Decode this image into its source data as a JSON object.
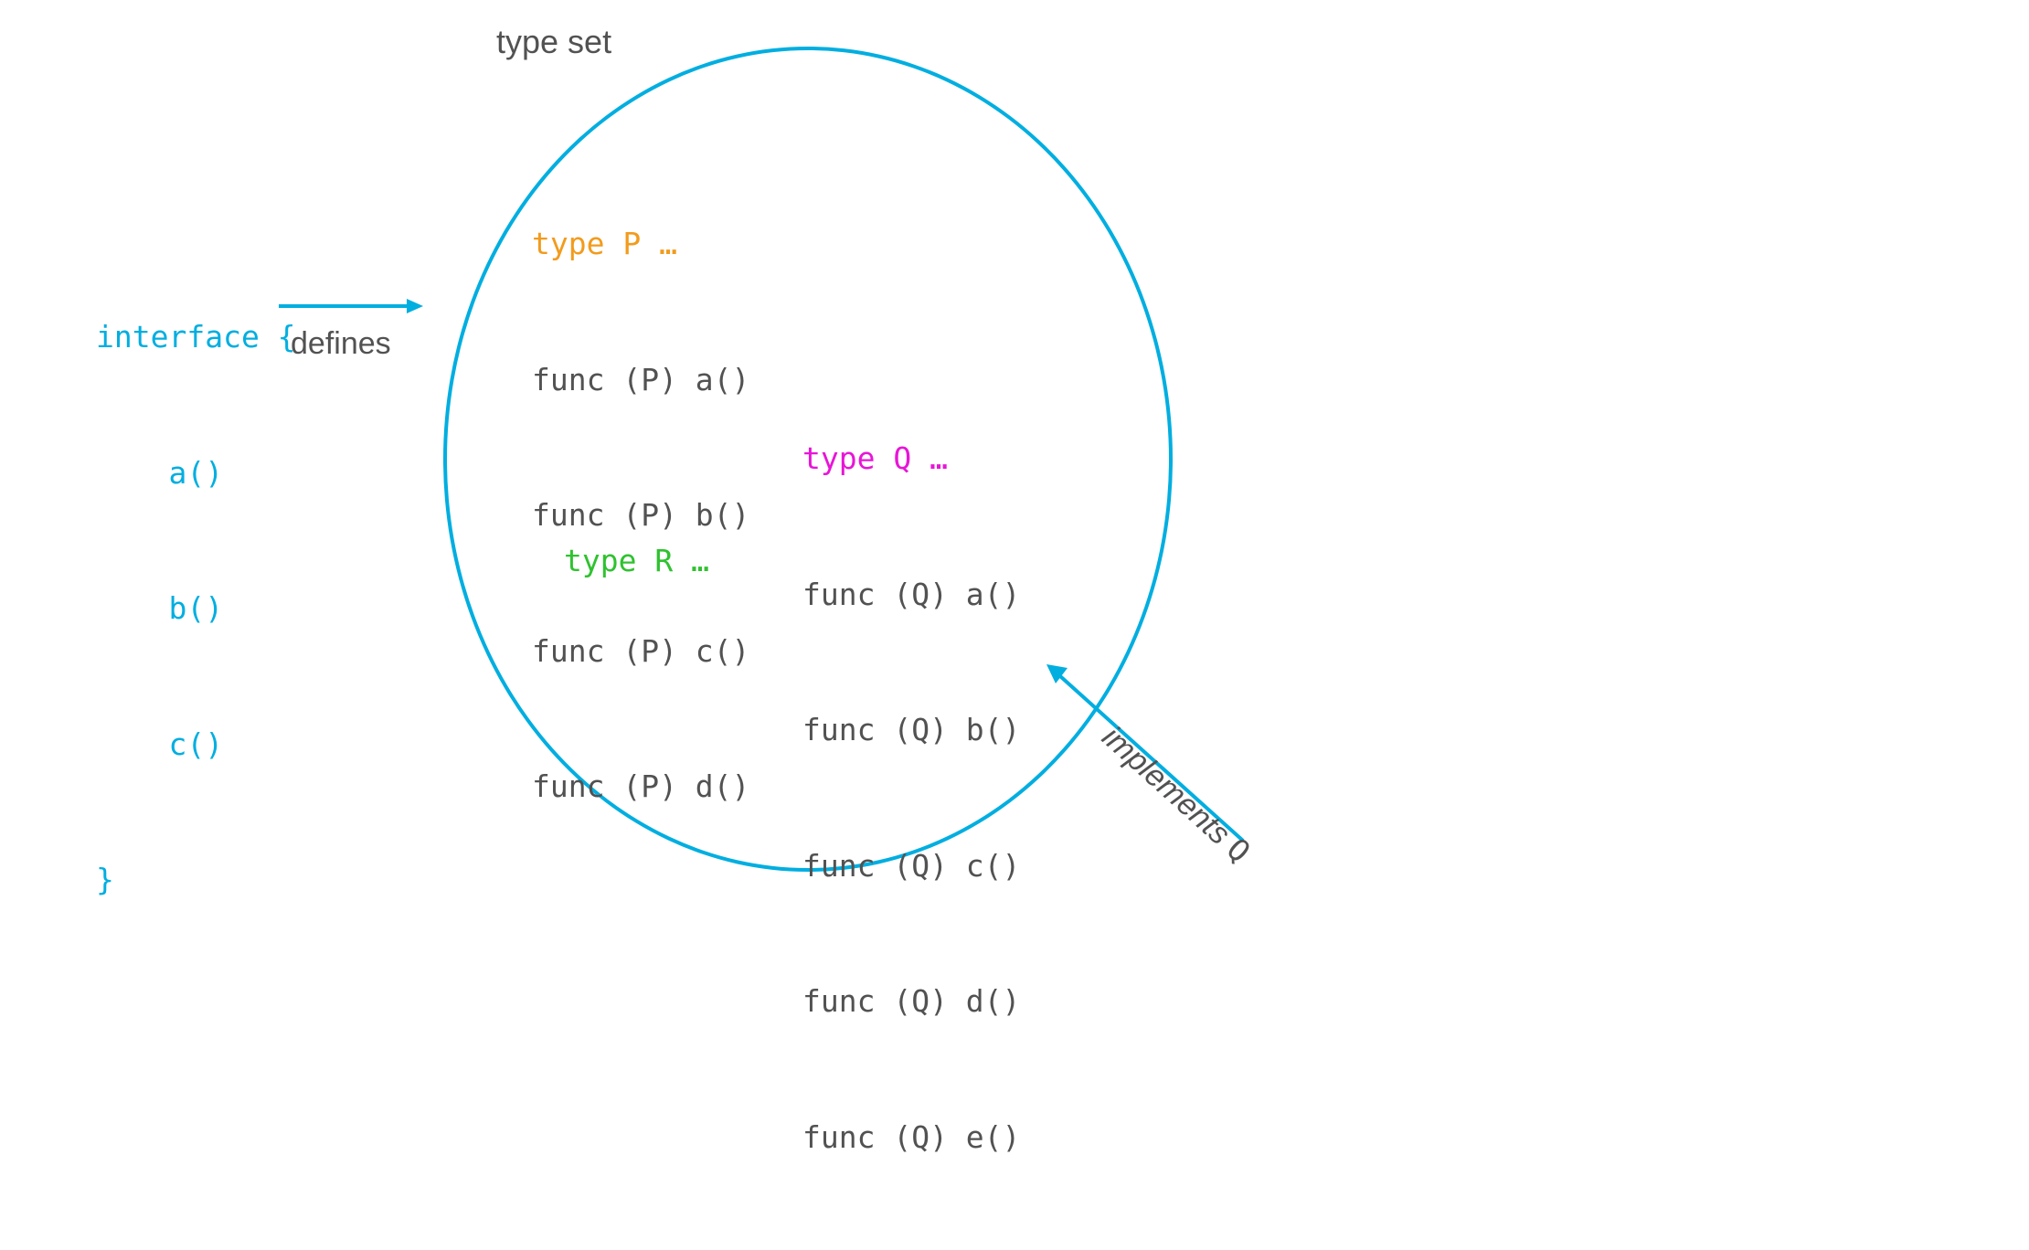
{
  "labels": {
    "typeSet": "type set",
    "defines": "defines",
    "implements": "implements ",
    "implementsQ": "Q"
  },
  "interfaceBlock": {
    "l1": "interface {",
    "l2": "    a()",
    "l3": "    b()",
    "l4": "    c()",
    "l5": "}"
  },
  "typeP": {
    "decl": "type P …",
    "m1": "func (P) a()",
    "m2": "func (P) b()",
    "m3": "func (P) c()",
    "m4": "func (P) d()"
  },
  "typeR": {
    "decl": "type R …"
  },
  "typeQ": {
    "decl": "type Q …",
    "m1": "func (Q) a()",
    "m2": "func (Q) b()",
    "m3": "func (Q) c()",
    "m4": "func (Q) d()",
    "m5": "func (Q) e()"
  },
  "colors": {
    "accent": "#00aee0",
    "text": "#525252",
    "orange": "#f29b1d",
    "green": "#2fc22f",
    "magenta": "#e815d7"
  }
}
